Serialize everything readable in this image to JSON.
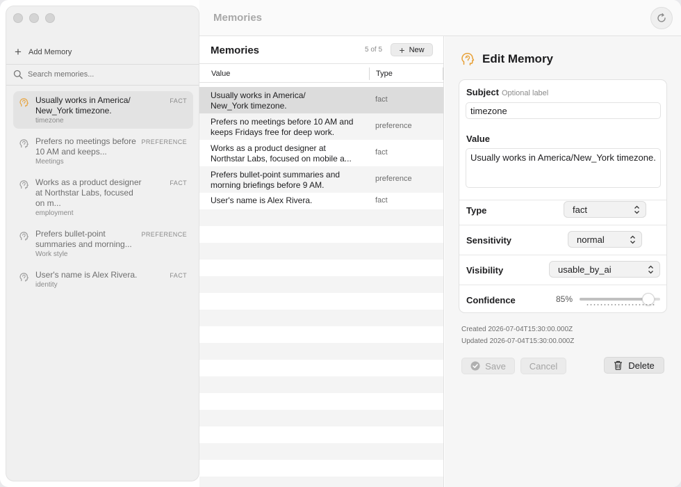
{
  "window": {
    "title": "Memories"
  },
  "sidebar": {
    "add_label": "Add Memory",
    "search_placeholder": "Search memories...",
    "items": [
      {
        "title": "Usually works in America/ New_York timezone.",
        "subject": "timezone",
        "badge": "FACT",
        "selected": true
      },
      {
        "title": "Prefers no meetings before 10 AM and keeps...",
        "subject": "Meetings",
        "badge": "PREFERENCE"
      },
      {
        "title": "Works as a product designer at Northstar Labs, focused on m...",
        "subject": "employment",
        "badge": "FACT"
      },
      {
        "title": "Prefers bullet-point summaries and morning...",
        "subject": "Work style",
        "badge": "PREFERENCE"
      },
      {
        "title": "User's name is Alex Rivera.",
        "subject": "identity",
        "badge": "FACT"
      }
    ]
  },
  "table": {
    "title": "Memories",
    "count": "5 of 5",
    "new_label": "New",
    "columns": {
      "value": "Value",
      "type": "Type"
    },
    "rows": [
      {
        "value": "Usually works in America/\nNew_York timezone.",
        "type": "fact"
      },
      {
        "value": "Prefers no meetings before 10 AM and\nkeeps Fridays free for deep work.",
        "type": "preference"
      },
      {
        "value": "Works as a product designer at\nNorthstar Labs, focused on mobile a...",
        "type": "fact"
      },
      {
        "value": "Prefers bullet-point summaries and\nmorning briefings before 9 AM.",
        "type": "preference"
      },
      {
        "value": "User's name is Alex Rivera.",
        "type": "fact"
      }
    ]
  },
  "editor": {
    "title": "Edit Memory",
    "subject_label": "Subject",
    "subject_hint": "Optional label",
    "subject_value": "timezone",
    "value_label": "Value",
    "value_text": "Usually works in America/New_York timezone.",
    "type_label": "Type",
    "type_value": "fact",
    "sensitivity_label": "Sensitivity",
    "sensitivity_value": "normal",
    "visibility_label": "Visibility",
    "visibility_value": "usable_by_ai",
    "confidence_label": "Confidence",
    "confidence_value": "85%",
    "confidence_fraction": 0.85,
    "created": "Created 2026-07-04T15:30:00.000Z",
    "updated": "Updated 2026-07-04T15:30:00.000Z",
    "save_label": "Save",
    "cancel_label": "Cancel",
    "delete_label": "Delete"
  },
  "colors": {
    "accent_icon": "#e8a23a",
    "muted_icon": "#9a9a9a"
  }
}
